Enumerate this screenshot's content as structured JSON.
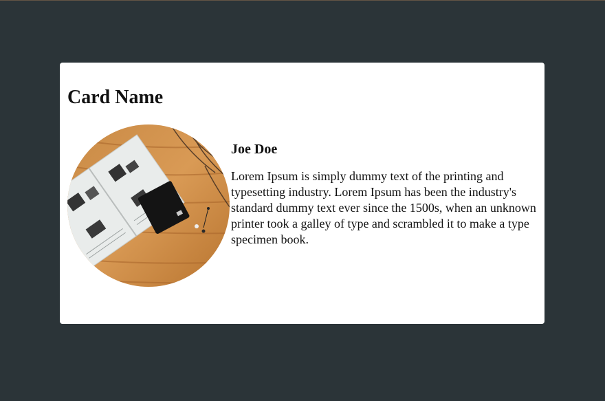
{
  "card": {
    "title": "Card Name",
    "person_name": "Joe Doe",
    "description": "Lorem Ipsum is simply dummy text of the printing and typesetting industry. Lorem Ipsum has been the industry's standard dummy text ever since the 1500s, when an unknown printer took a galley of type and scrambled it to make a type specimen book.",
    "image_icon": "profile-photo-icon"
  },
  "colors": {
    "page_background": "#2b3438",
    "card_background": "#ffffff",
    "text": "#111111"
  }
}
